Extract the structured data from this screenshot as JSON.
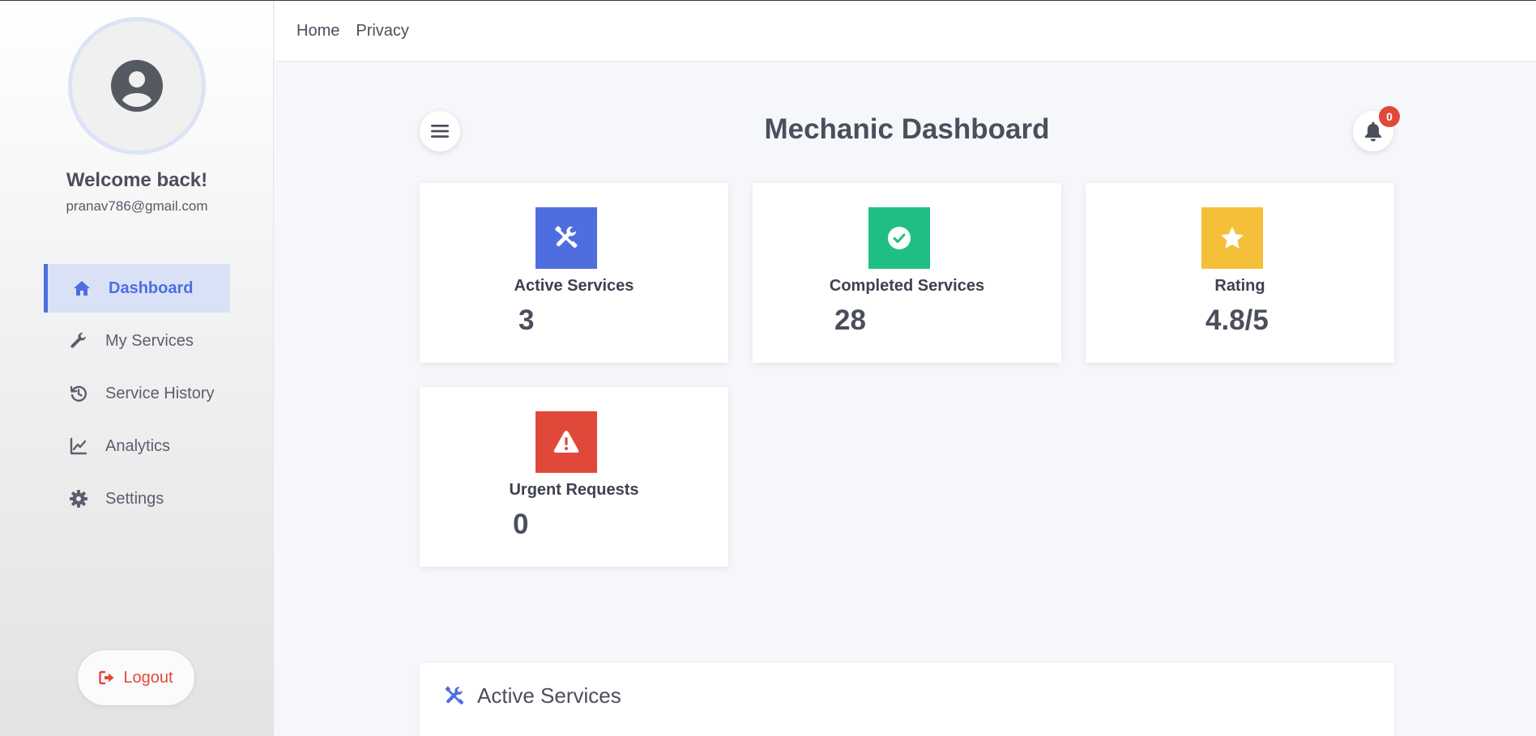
{
  "colors": {
    "accent": "#4e6ee0",
    "success": "#1fbf83",
    "warning": "#f5bf3a",
    "danger": "#e0493a",
    "text": "#4b4f5c"
  },
  "sidebar": {
    "welcome": "Welcome back!",
    "email": "pranav786@gmail.com",
    "items": [
      {
        "label": "Dashboard",
        "icon": "home-icon",
        "active": true
      },
      {
        "label": "My Services",
        "icon": "wrench-icon"
      },
      {
        "label": "Service History",
        "icon": "history-icon"
      },
      {
        "label": "Analytics",
        "icon": "chart-line-icon"
      },
      {
        "label": "Settings",
        "icon": "gear-icon"
      }
    ],
    "logout_label": "Logout"
  },
  "topnav": {
    "links": [
      "Home",
      "Privacy"
    ]
  },
  "header": {
    "title": "Mechanic Dashboard",
    "notification_count": "0"
  },
  "stats": [
    {
      "label": "Active Services",
      "value": "3",
      "icon": "tools-icon",
      "color": "#4e6ee0"
    },
    {
      "label": "Completed Services",
      "value": "28",
      "icon": "check-circle-icon",
      "color": "#1fbf83"
    },
    {
      "label": "Rating",
      "value": "4.8/5",
      "icon": "star-icon",
      "color": "#f5bf3a"
    },
    {
      "label": "Urgent Requests",
      "value": "0",
      "icon": "warning-icon",
      "color": "#e0493a"
    }
  ],
  "active_services": {
    "title": "Active Services"
  }
}
